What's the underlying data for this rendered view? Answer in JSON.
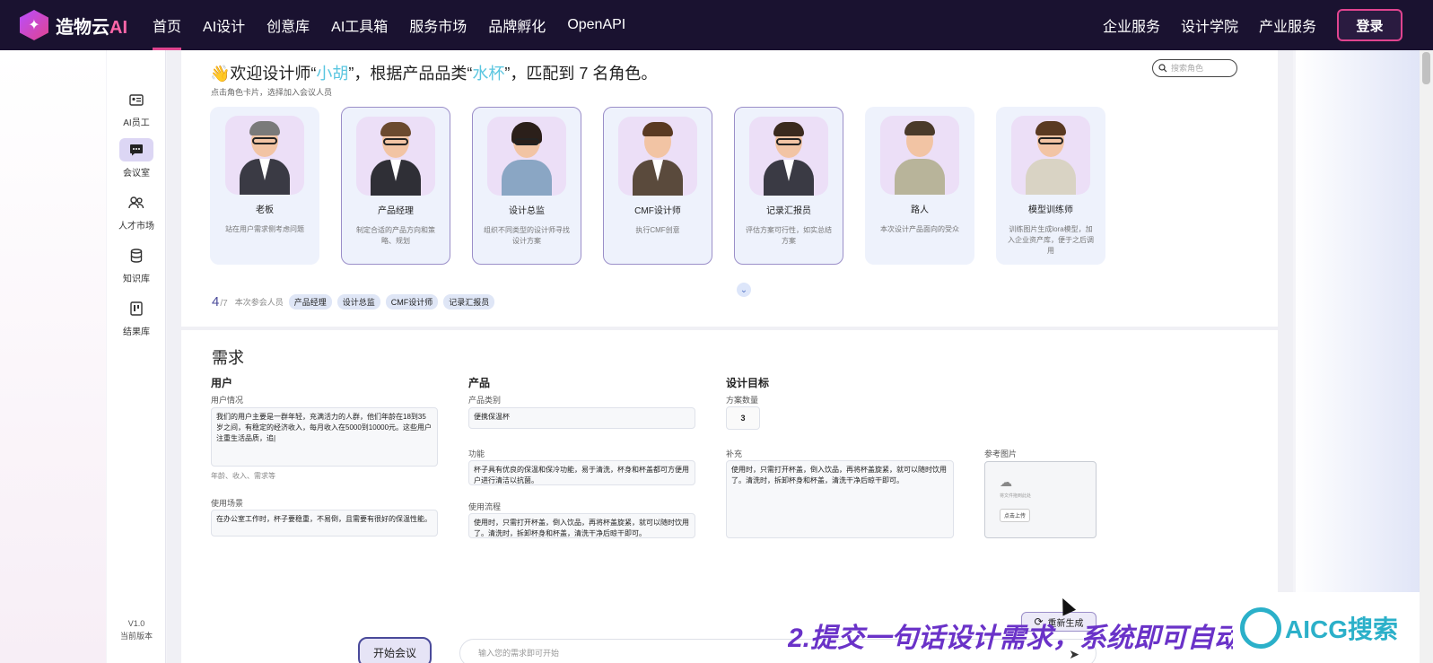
{
  "nav": {
    "brand": "造物云",
    "brand_ai": "AI",
    "items_left": [
      "首页",
      "AI设计",
      "创意库",
      "AI工具箱",
      "服务市场",
      "品牌孵化",
      "OpenAPI"
    ],
    "items_right": [
      "企业服务",
      "设计学院",
      "产业服务"
    ],
    "login_label": "登录"
  },
  "sidebar": {
    "items": [
      {
        "label": "AI员工",
        "icon": "id-card-icon"
      },
      {
        "label": "会议室",
        "icon": "chat-icon"
      },
      {
        "label": "人才市场",
        "icon": "people-icon"
      },
      {
        "label": "知识库",
        "icon": "database-icon"
      },
      {
        "label": "结果库",
        "icon": "board-icon"
      }
    ],
    "version": "V1.0",
    "version_label": "当前版本"
  },
  "welcome": {
    "prefix": "👋欢迎设计师“",
    "designer": "小胡",
    "middle": "”，根据产品品类“",
    "category": "水杯",
    "suffix": "”，匹配到 7 名角色。",
    "hint": "点击角色卡片，选择加入会议人员"
  },
  "search": {
    "placeholder": "搜索角色"
  },
  "roles": [
    {
      "name": "老板",
      "desc": "站在用户需求侧考虑问题"
    },
    {
      "name": "产品经理",
      "desc": "制定合适的产品方向和策略、规划"
    },
    {
      "name": "设计总监",
      "desc": "组织不同类型的设计师寻找设计方案"
    },
    {
      "name": "CMF设计师",
      "desc": "执行CMF创意"
    },
    {
      "name": "记录汇报员",
      "desc": "评估方案可行性，如实总结方案"
    },
    {
      "name": "路人",
      "desc": "本次设计产品面向的受众"
    },
    {
      "name": "模型训练师",
      "desc": "训练图片生成lora模型，加入企业资产库，便于之后调用"
    }
  ],
  "participants": {
    "count": "4",
    "total": "/7",
    "label": "本次参会人员",
    "chips": [
      "产品经理",
      "设计总监",
      "CMF设计师",
      "记录汇报员"
    ]
  },
  "requirements": {
    "title": "需求",
    "user": {
      "title": "用户",
      "situation_label": "用户情况",
      "situation_value": "我们的用户主要是一群年轻，充满活力的人群，他们年龄在18到35岁之间，有稳定的经济收入，每月收入在5000到10000元。这些用户注重生活品质，追|",
      "situation_hint": "年龄、收入、需求等",
      "scene_label": "使用场景",
      "scene_value": "在办公室工作时，杯子要稳重，不易倒，且需要有很好的保温性能。"
    },
    "product": {
      "title": "产品",
      "category_label": "产品类别",
      "category_value": "便携保温杯",
      "function_label": "功能",
      "function_value": "杯子具有优良的保温和保冷功能，易于清洗，杯身和杯盖都可方便用户进行清洁以抗菌。",
      "flow_label": "使用流程",
      "flow_value": "使用时，只需打开杯盖，倒入饮品，再将杯盖旋紧，就可以随时饮用了。清洗时，拆卸杯身和杯盖，清洗干净后晾干即可。"
    },
    "goal": {
      "title": "设计目标",
      "qty_label": "方案数量",
      "qty_value": "3",
      "supplement_label": "补充",
      "supplement_value": "使用时，只需打开杯盖，倒入饮品，再将杯盖旋紧，就可以随时饮用了。清洗时，拆卸杯身和杯盖，清洗干净后晾干即可。",
      "ref_label": "参考图片",
      "upload_text": "将文件拖到此处",
      "upload_btn": "点击上传"
    }
  },
  "actions": {
    "regen_label": "重新生成",
    "start_label": "开始会议",
    "prompt_placeholder": "输入您的需求即可开始"
  },
  "caption": "2.提交一句话设计需求，系统即可自动",
  "watermark": "AICG搜索"
}
